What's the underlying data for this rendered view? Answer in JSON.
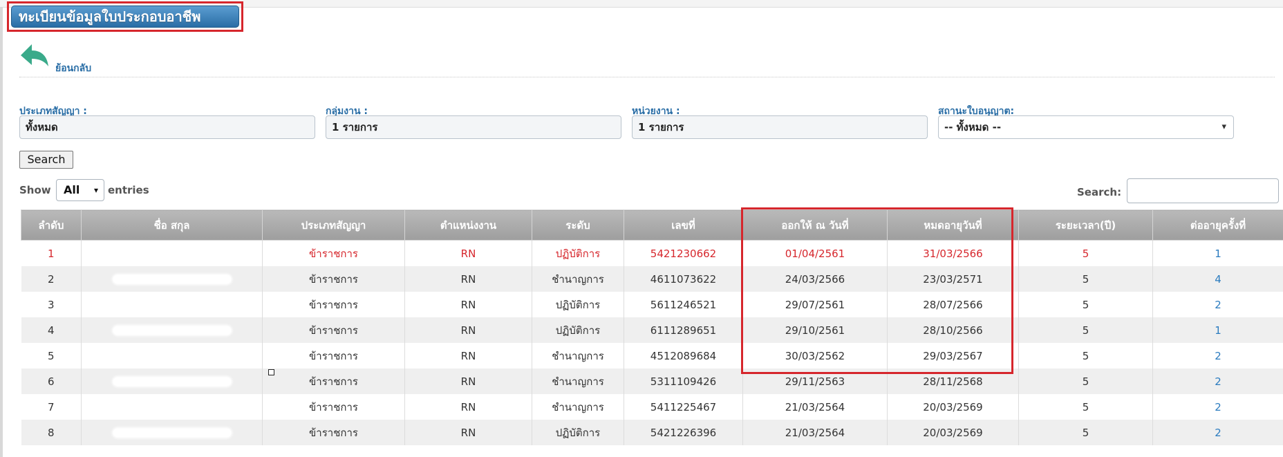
{
  "page_title": "ทะเบียนข้อมูลใบประกอบอาชีพ",
  "back_link": {
    "label": "ย้อนกลับ",
    "icon": "back-arrow-icon",
    "icon_color": "#3aaa8a"
  },
  "filters": {
    "contract_type": {
      "label": "ประเภทสัญญา :",
      "value": "ทั้งหมด"
    },
    "work_group": {
      "label": "กลุ่มงาน :",
      "value": "1 รายการ"
    },
    "unit": {
      "label": "หน่วยงาน :",
      "value": "1 รายการ"
    },
    "license_status": {
      "label": "สถานะใบอนุญาต:",
      "value": "-- ทั้งหมด --"
    }
  },
  "search_button": "Search",
  "length_control": {
    "show": "Show",
    "value": "All",
    "entries": "entries"
  },
  "table_search": {
    "label": "Search:",
    "value": ""
  },
  "table": {
    "columns": [
      "ลำดับ",
      "ชื่อ สกุล",
      "ประเภทสัญญา",
      "ตำแหน่งงาน",
      "ระดับ",
      "เลขที่",
      "ออกให้ ณ วันที่",
      "หมดอายุวันที่",
      "ระยะเวลา(ปี)",
      "ต่ออายุครั้งที่"
    ],
    "rows": [
      {
        "no": "1",
        "contract": "ข้าราชการ",
        "position": "RN",
        "level": "ปฏิบัติการ",
        "number": "5421230662",
        "issued": "01/04/2561",
        "expires": "31/03/2566",
        "years": "5",
        "renewal": "1"
      },
      {
        "no": "2",
        "contract": "ข้าราชการ",
        "position": "RN",
        "level": "ชำนาญการ",
        "number": "4611073622",
        "issued": "24/03/2566",
        "expires": "23/03/2571",
        "years": "5",
        "renewal": "4"
      },
      {
        "no": "3",
        "contract": "ข้าราชการ",
        "position": "RN",
        "level": "ปฏิบัติการ",
        "number": "5611246521",
        "issued": "29/07/2561",
        "expires": "28/07/2566",
        "years": "5",
        "renewal": "2"
      },
      {
        "no": "4",
        "contract": "ข้าราชการ",
        "position": "RN",
        "level": "ปฏิบัติการ",
        "number": "6111289651",
        "issued": "29/10/2561",
        "expires": "28/10/2566",
        "years": "5",
        "renewal": "1"
      },
      {
        "no": "5",
        "contract": "ข้าราชการ",
        "position": "RN",
        "level": "ชำนาญการ",
        "number": "4512089684",
        "issued": "30/03/2562",
        "expires": "29/03/2567",
        "years": "5",
        "renewal": "2"
      },
      {
        "no": "6",
        "contract": "ข้าราชการ",
        "position": "RN",
        "level": "ชำนาญการ",
        "number": "5311109426",
        "issued": "29/11/2563",
        "expires": "28/11/2568",
        "years": "5",
        "renewal": "2"
      },
      {
        "no": "7",
        "contract": "ข้าราชการ",
        "position": "RN",
        "level": "ชำนาญการ",
        "number": "5411225467",
        "issued": "21/03/2564",
        "expires": "20/03/2569",
        "years": "5",
        "renewal": "2"
      },
      {
        "no": "8",
        "contract": "ข้าราชการ",
        "position": "RN",
        "level": "ปฏิบัติการ",
        "number": "5421226396",
        "issued": "21/03/2564",
        "expires": "20/03/2569",
        "years": "5",
        "renewal": "2"
      }
    ]
  },
  "colors": {
    "header_bg": "#a8a8a8",
    "accent_blue": "#2a6ea6",
    "highlight_red": "#d6262c",
    "first_row_text": "#d6262c"
  }
}
